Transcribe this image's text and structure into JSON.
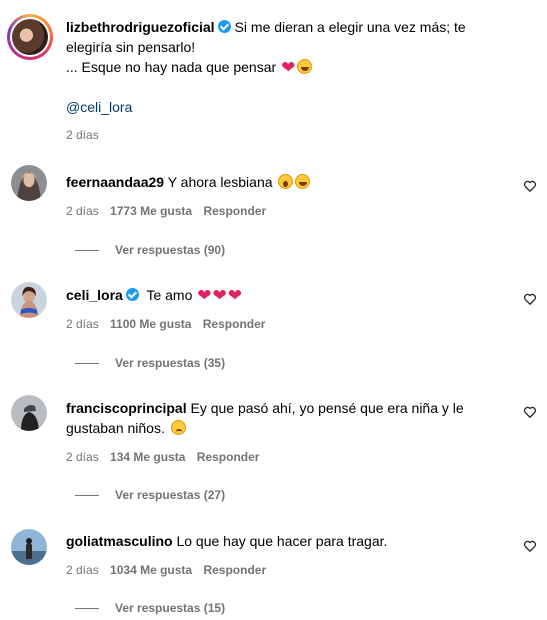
{
  "post": {
    "username": "lizbethrodriguezoficial",
    "caption_line1": "Si me dieran a elegir una vez más; te",
    "caption_line2": "elegiría sin pensarlo!",
    "caption_line3": "... Esque no hay nada que pensar",
    "mention": "@celi_lora",
    "time": "2 días"
  },
  "comments": [
    {
      "username": "feernaandaa29",
      "text": "Y ahora lesbiana",
      "time": "2 días",
      "likes": "1773 Me gusta",
      "reply": "Responder",
      "view_replies": "Ver respuestas (90)"
    },
    {
      "username": "celi_lora",
      "text": "Te amo",
      "time": "2 días",
      "likes": "1100 Me gusta",
      "reply": "Responder",
      "view_replies": "Ver respuestas (35)"
    },
    {
      "username": "franciscoprincipal",
      "text_line1": "Ey que pasó ahí, yo pensé que era niña y le",
      "text_line2": "gustaban niños.",
      "time": "2 días",
      "likes": "134 Me gusta",
      "reply": "Responder",
      "view_replies": "Ver respuestas (27)"
    },
    {
      "username": "goliatmasculino",
      "text": "Lo que hay que hacer para tragar.",
      "time": "2 días",
      "likes": "1034 Me gusta",
      "reply": "Responder",
      "view_replies": "Ver respuestas (15)"
    }
  ],
  "colors": {
    "muted": "#737373",
    "link": "#00376b",
    "verified": "#1d9bf0",
    "heart": "#e0245e"
  }
}
